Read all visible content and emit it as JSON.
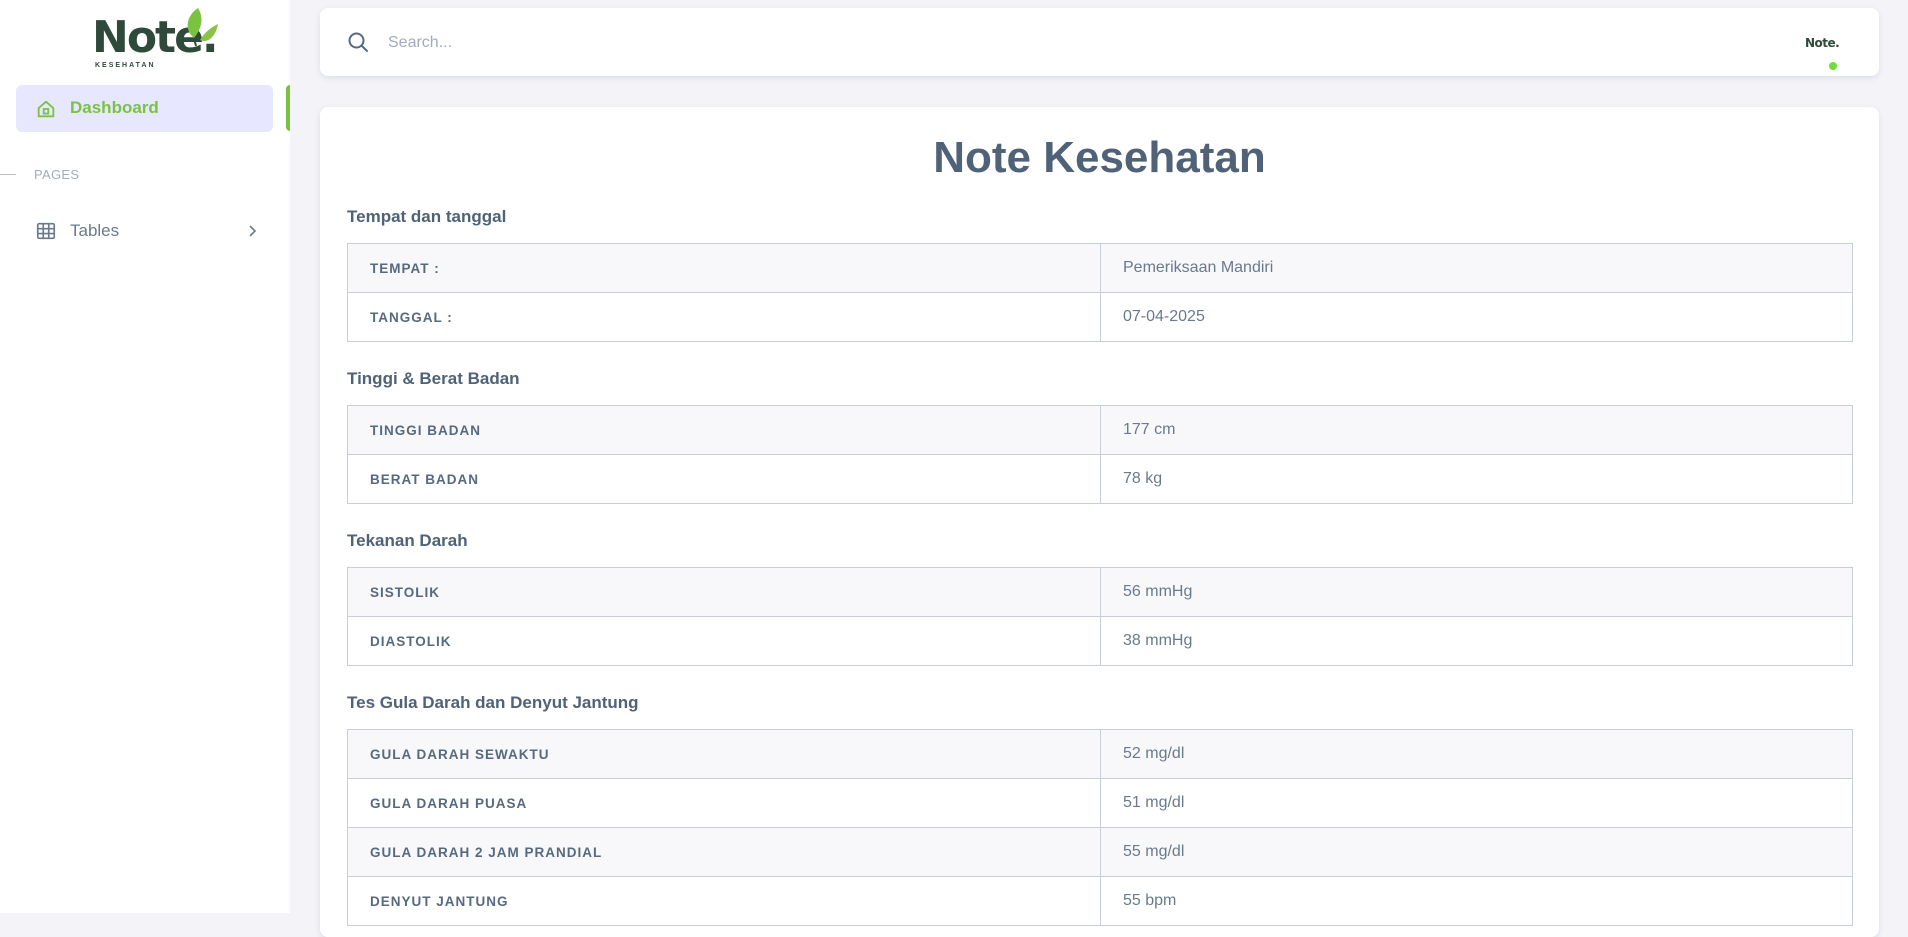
{
  "brand": {
    "logo_text": "Note.",
    "logo_sub": "KESEHATAN",
    "avatar_text": "Note.",
    "accent": "#7cc242"
  },
  "sidebar": {
    "items": [
      {
        "label": "Dashboard",
        "icon": "home-icon",
        "active": true
      }
    ],
    "section_label": "PAGES",
    "pages": [
      {
        "label": "Tables",
        "icon": "table-icon"
      }
    ]
  },
  "search": {
    "placeholder": "Search..."
  },
  "main": {
    "title": "Note Kesehatan",
    "sections": [
      {
        "title": "Tempat dan tanggal",
        "rows": [
          {
            "key": "TEMPAT :",
            "value": "Pemeriksaan Mandiri"
          },
          {
            "key": "TANGGAL :",
            "value": "07-04-2025"
          }
        ]
      },
      {
        "title": "Tinggi & Berat Badan",
        "rows": [
          {
            "key": "TINGGI BADAN",
            "value": "177 cm"
          },
          {
            "key": "BERAT BADAN",
            "value": "78 kg"
          }
        ]
      },
      {
        "title": "Tekanan Darah",
        "rows": [
          {
            "key": "SISTOLIK",
            "value": "56 mmHg"
          },
          {
            "key": "DIASTOLIK",
            "value": "38 mmHg"
          }
        ]
      },
      {
        "title": "Tes Gula Darah dan Denyut Jantung",
        "rows": [
          {
            "key": "GULA DARAH SEWAKTU",
            "value": "52 mg/dl"
          },
          {
            "key": "GULA DARAH PUASA",
            "value": "51 mg/dl"
          },
          {
            "key": "GULA DARAH 2 JAM PRANDIAL",
            "value": "55 mg/dl"
          },
          {
            "key": "DENYUT JANTUNG",
            "value": "55 bpm"
          }
        ]
      }
    ]
  }
}
